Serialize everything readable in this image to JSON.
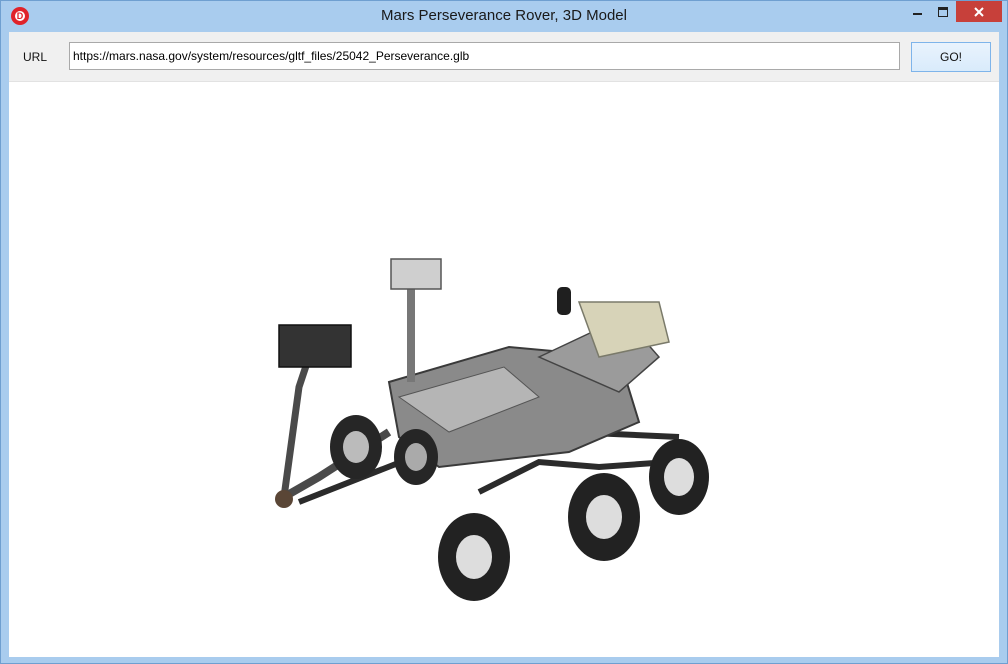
{
  "window": {
    "title": "Mars Perseverance Rover, 3D Model",
    "app_icon": "d-logo-icon",
    "controls": [
      "minimize-icon",
      "maximize-icon",
      "close-icon"
    ],
    "accent_color": "#a9ccee",
    "close_color": "#c7403a"
  },
  "toolbar": {
    "url_label": "URL",
    "url_value": "https://mars.nasa.gov/system/resources/gltf_files/25042_Perseverance.glb",
    "go_label": "GO!"
  },
  "viewport": {
    "content": "3d-rover-model"
  }
}
